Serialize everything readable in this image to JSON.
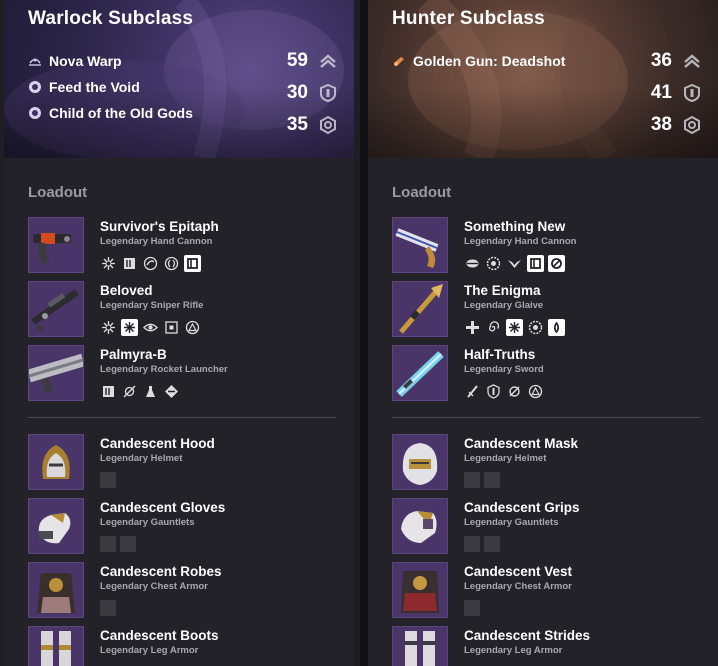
{
  "warlock": {
    "title": "Warlock Subclass",
    "abilities": [
      {
        "label": "Nova Warp",
        "icon": "void-warp-icon"
      },
      {
        "label": "Feed the Void",
        "icon": "void-aspect-icon"
      },
      {
        "label": "Child of the Old Gods",
        "icon": "void-aspect-icon"
      }
    ],
    "stats": [
      {
        "value": "59",
        "icon": "mobility-icon"
      },
      {
        "value": "30",
        "icon": "resilience-icon"
      },
      {
        "value": "35",
        "icon": "recovery-icon"
      }
    ],
    "loadout_label": "Loadout",
    "weapons": [
      {
        "name": "Survivor's Epitaph",
        "type": "Legendary Hand Cannon"
      },
      {
        "name": "Beloved",
        "type": "Legendary Sniper Rifle"
      },
      {
        "name": "Palmyra-B",
        "type": "Legendary Rocket Launcher"
      }
    ],
    "armor": [
      {
        "name": "Candescent Hood",
        "type": "Legendary Helmet"
      },
      {
        "name": "Candescent Gloves",
        "type": "Legendary Gauntlets"
      },
      {
        "name": "Candescent Robes",
        "type": "Legendary Chest Armor"
      },
      {
        "name": "Candescent Boots",
        "type": "Legendary Leg Armor"
      }
    ]
  },
  "hunter": {
    "title": "Hunter Subclass",
    "abilities": [
      {
        "label": "Golden Gun: Deadshot",
        "icon": "solar-gun-icon"
      }
    ],
    "stats": [
      {
        "value": "36",
        "icon": "mobility-icon"
      },
      {
        "value": "41",
        "icon": "resilience-icon"
      },
      {
        "value": "38",
        "icon": "recovery-icon"
      }
    ],
    "loadout_label": "Loadout",
    "weapons": [
      {
        "name": "Something New",
        "type": "Legendary Hand Cannon"
      },
      {
        "name": "The Enigma",
        "type": "Legendary Glaive"
      },
      {
        "name": "Half-Truths",
        "type": "Legendary Sword"
      }
    ],
    "armor": [
      {
        "name": "Candescent Mask",
        "type": "Legendary Helmet"
      },
      {
        "name": "Candescent Grips",
        "type": "Legendary Gauntlets"
      },
      {
        "name": "Candescent Vest",
        "type": "Legendary Chest Armor"
      },
      {
        "name": "Candescent Strides",
        "type": "Legendary Leg Armor"
      }
    ]
  },
  "colors": {
    "warlock_accent": "#3d3262",
    "hunter_accent": "#5a3f36",
    "item_tile": "#4a3568",
    "panel_bg": "#232228"
  }
}
